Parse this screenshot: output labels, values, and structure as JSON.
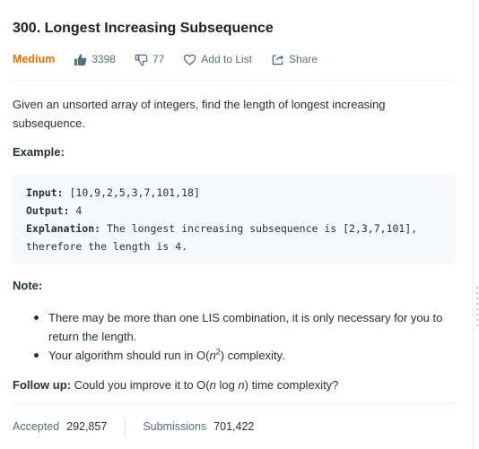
{
  "problem": {
    "title": "300. Longest Increasing Subsequence",
    "difficulty": "Medium",
    "likes": "3398",
    "dislikes": "77",
    "add_to_list": "Add to List",
    "share": "Share"
  },
  "description": {
    "text": "Given an unsorted array of integers, find the length of longest increasing subsequence."
  },
  "example": {
    "heading": "Example:",
    "input_label": "Input:",
    "input_value": " [10,9,2,5,3,7,101,18]",
    "output_label": "Output:",
    "output_value": " 4",
    "explanation_label": "Explanation:",
    "explanation_line1": " The longest increasing subsequence is [2,3,7,101],",
    "explanation_line2": "therefore the length is 4."
  },
  "note": {
    "heading": "Note:",
    "item1": "There may be more than one LIS combination, it is only necessary for you to return the length.",
    "item2_prefix": "Your algorithm should run in O(",
    "item2_var": "n",
    "item2_exp": "2",
    "item2_suffix": ") complexity."
  },
  "followup": {
    "label": "Follow up:",
    "prefix": " Could you improve it to O(",
    "var1": "n",
    "mid": " log ",
    "var2": "n",
    "suffix": ") time complexity?"
  },
  "stats": {
    "accepted_label": "Accepted",
    "accepted_value": "292,857",
    "submissions_label": "Submissions",
    "submissions_value": "701,422"
  },
  "colors": {
    "difficulty_medium": "#ef6c00",
    "text": "#263238",
    "muted": "#546e7a",
    "code_bg": "#f7f9fa"
  },
  "icons": [
    "thumbs-up-icon",
    "thumbs-down-icon",
    "heart-icon",
    "share-icon"
  ]
}
